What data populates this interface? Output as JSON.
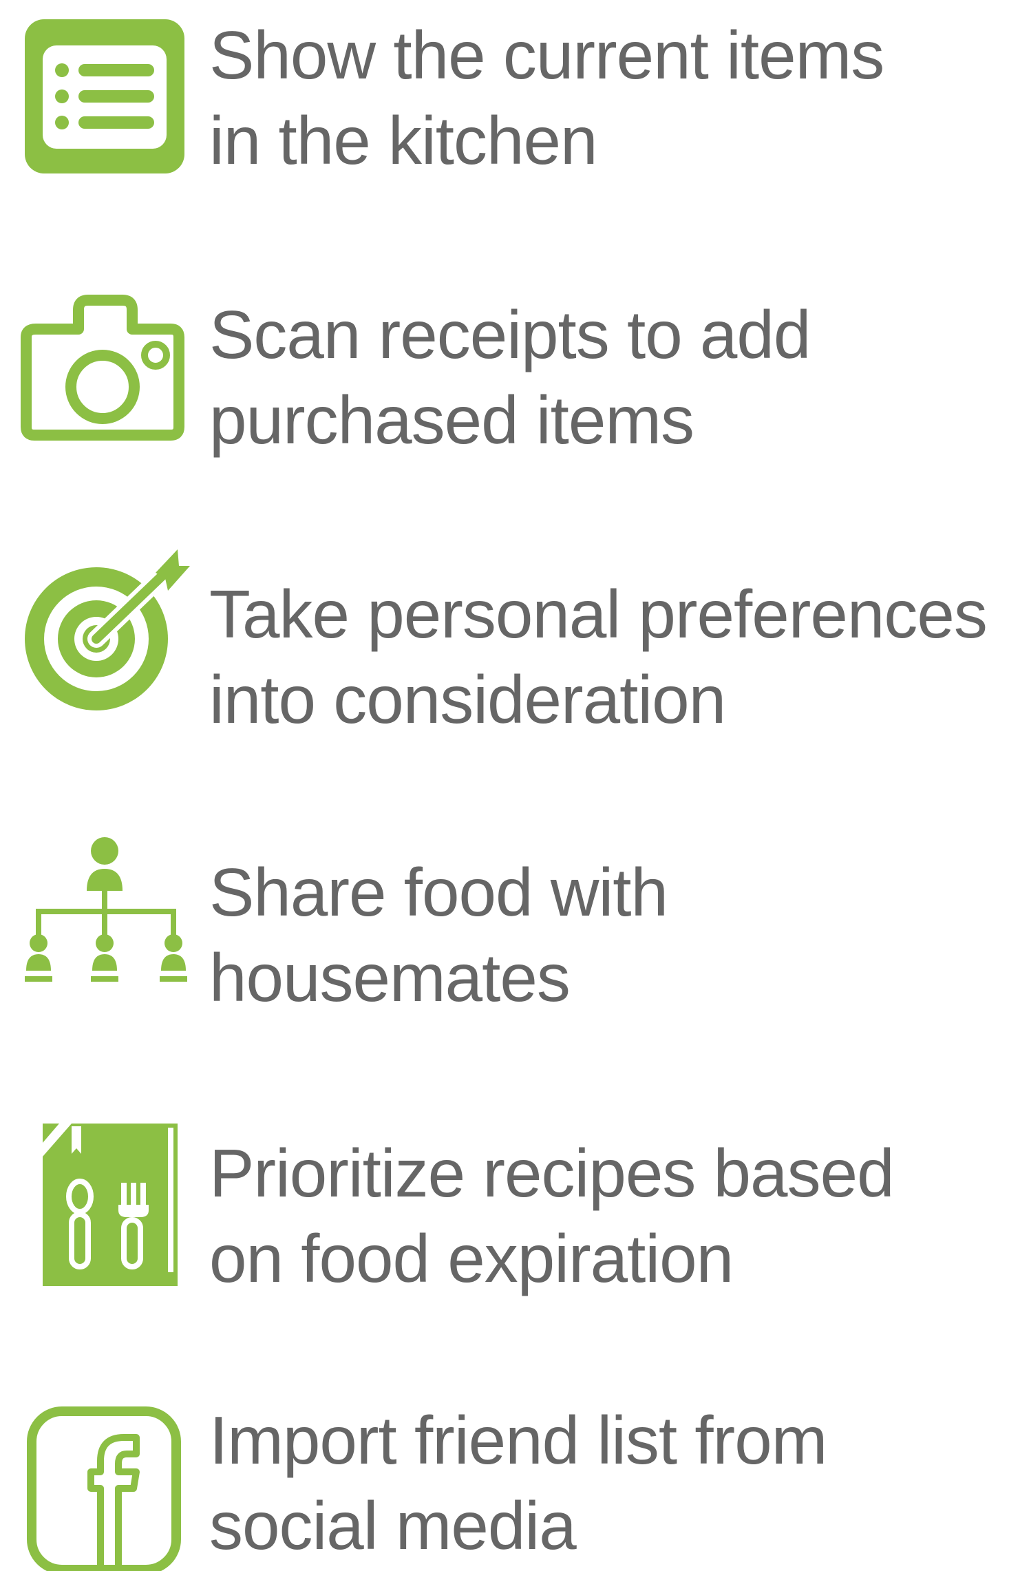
{
  "accent_color": "#8cbf44",
  "text_color": "#666666",
  "features": [
    {
      "icon": "list-icon",
      "lines": [
        "Show the current items",
        "in the kitchen"
      ]
    },
    {
      "icon": "camera-icon",
      "lines": [
        "Scan receipts to add",
        "purchased items"
      ]
    },
    {
      "icon": "target-icon",
      "lines": [
        "Take personal preferences",
        "into consideration"
      ]
    },
    {
      "icon": "sharing-network-icon",
      "lines": [
        "Share food with",
        "housemates"
      ]
    },
    {
      "icon": "recipe-book-icon",
      "lines": [
        "Prioritize recipes based",
        "on food expiration"
      ]
    },
    {
      "icon": "facebook-icon",
      "lines": [
        "Import friend list from",
        "social media"
      ]
    }
  ]
}
